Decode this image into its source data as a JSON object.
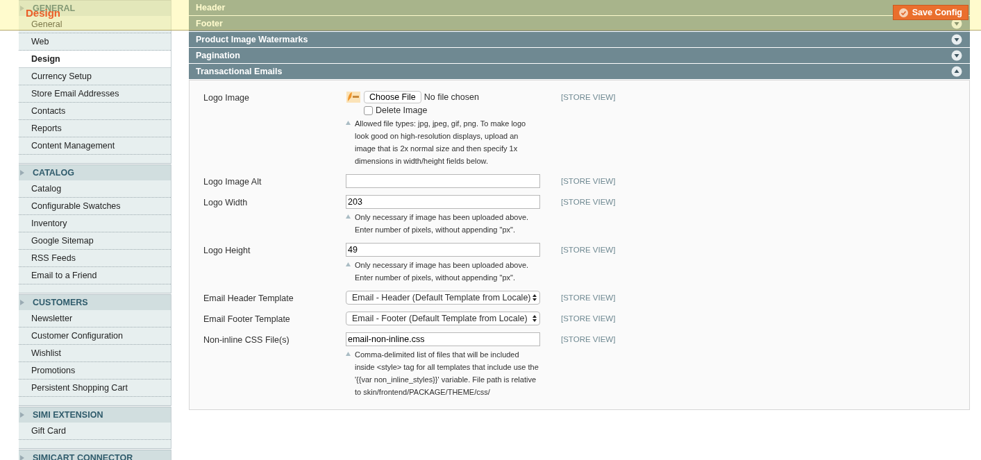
{
  "page_header": {
    "title": "Design",
    "save_button": "Save Config"
  },
  "sidebar": {
    "groups": [
      {
        "title": "GENERAL",
        "items": [
          {
            "label": "General",
            "selected": false
          },
          {
            "label": "Web",
            "selected": false
          },
          {
            "label": "Design",
            "selected": true
          },
          {
            "label": "Currency Setup",
            "selected": false
          },
          {
            "label": "Store Email Addresses",
            "selected": false
          },
          {
            "label": "Contacts",
            "selected": false
          },
          {
            "label": "Reports",
            "selected": false
          },
          {
            "label": "Content Management",
            "selected": false
          }
        ]
      },
      {
        "title": "CATALOG",
        "items": [
          {
            "label": "Catalog",
            "selected": false
          },
          {
            "label": "Configurable Swatches",
            "selected": false
          },
          {
            "label": "Inventory",
            "selected": false
          },
          {
            "label": "Google Sitemap",
            "selected": false
          },
          {
            "label": "RSS Feeds",
            "selected": false
          },
          {
            "label": "Email to a Friend",
            "selected": false
          }
        ]
      },
      {
        "title": "CUSTOMERS",
        "items": [
          {
            "label": "Newsletter",
            "selected": false
          },
          {
            "label": "Customer Configuration",
            "selected": false
          },
          {
            "label": "Wishlist",
            "selected": false
          },
          {
            "label": "Promotions",
            "selected": false
          },
          {
            "label": "Persistent Shopping Cart",
            "selected": false
          }
        ]
      },
      {
        "title": "SIMI EXTENSION",
        "items": [
          {
            "label": "Gift Card",
            "selected": false
          }
        ]
      },
      {
        "title": "SIMICART CONNECTOR"
      }
    ]
  },
  "sections": [
    {
      "title": "Header"
    },
    {
      "title": "Footer",
      "expanded": false
    },
    {
      "title": "Product Image Watermarks",
      "expanded": false
    },
    {
      "title": "Pagination",
      "expanded": false
    },
    {
      "title": "Transactional Emails",
      "expanded": true
    }
  ],
  "fields": [
    {
      "kind": "file",
      "label": "Logo Image",
      "button": "Choose File",
      "value": "No file chosen",
      "delete_label": "Delete Image",
      "delete_checked": false,
      "scope": "[STORE VIEW]",
      "note": "Allowed file types: jpg, jpeg, gif, png. To make logo look good on high-resolution displays, upload an image that is 2x normal size and then specify 1x dimensions in width/height fields below."
    },
    {
      "kind": "text",
      "label": "Logo Image Alt",
      "scope": "[STORE VIEW]"
    },
    {
      "kind": "text",
      "label": "Logo Width",
      "value": "203",
      "scope": "[STORE VIEW]",
      "note": "Only necessary if image has been uploaded above. Enter number of pixels, without appending \"px\"."
    },
    {
      "kind": "text",
      "label": "Logo Height",
      "value": "49",
      "scope": "[STORE VIEW]",
      "note": "Only necessary if image has been uploaded above. Enter number of pixels, without appending \"px\"."
    },
    {
      "kind": "select",
      "label": "Email Header Template",
      "value": "Email - Header (Default Template from Locale)",
      "scope": "[STORE VIEW]"
    },
    {
      "kind": "select",
      "label": "Email Footer Template",
      "value": "Email - Footer (Default Template from Locale)",
      "scope": "[STORE VIEW]"
    },
    {
      "kind": "text",
      "label": "Non-inline CSS File(s)",
      "value": "email-non-inline.css",
      "scope": "[STORE VIEW]",
      "note": "Comma-delimited list of files that will be included inside <style> tag for all templates that include use the '{{var non_inline_styles}}' variable. File path is relative to skin/frontend/PACKAGE/THEME/css/"
    }
  ]
}
